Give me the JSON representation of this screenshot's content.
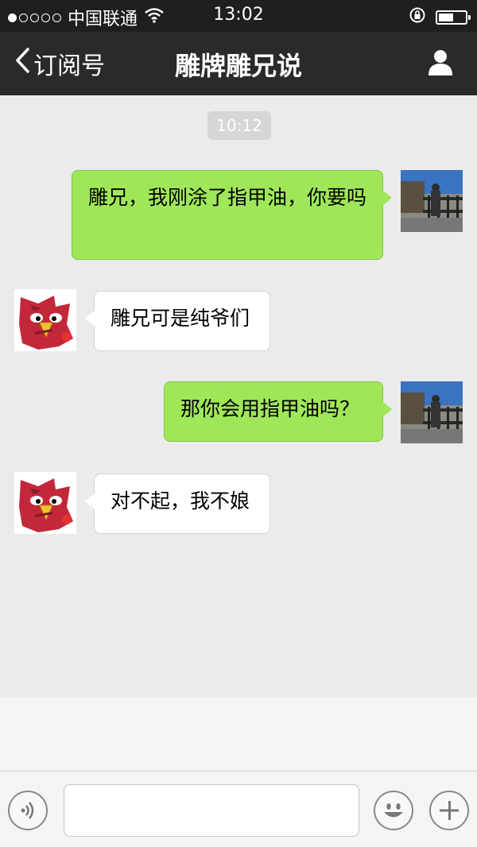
{
  "status_bar": {
    "carrier": "中国联通",
    "time": "13:02",
    "icons": [
      "signal-dots-icon",
      "wifi-icon",
      "rotation-lock-icon",
      "battery-icon"
    ],
    "battery_level": 0.55
  },
  "nav": {
    "back_label": "订阅号",
    "title": "雕牌雕兄说",
    "icons": [
      "chevron-left-icon",
      "user-icon"
    ]
  },
  "chat": {
    "timestamp": "10:12",
    "messages": [
      {
        "side": "me",
        "text": "雕兄，我刚涂了指甲油，你要吗"
      },
      {
        "side": "them",
        "text": "雕兄可是纯爷们"
      },
      {
        "side": "me",
        "text": "那你会用指甲油吗？"
      },
      {
        "side": "them",
        "text": "对不起，我不娘"
      }
    ]
  },
  "input_bar": {
    "text_value": "",
    "icons": [
      "voice-icon",
      "emoji-icon",
      "plus-icon"
    ]
  },
  "colors": {
    "my_bubble": "#9fe758",
    "their_bubble": "#ffffff",
    "nav_bg": "#2a2a2a",
    "chat_bg": "#ebebeb"
  }
}
